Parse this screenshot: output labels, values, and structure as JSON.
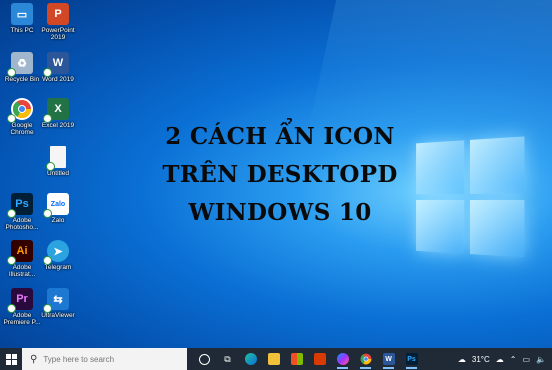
{
  "headline": {
    "line1": "2 CÁCH ẨN ICON",
    "line2": "TRÊN DESKTOPD",
    "line3": "WINDOWS 10"
  },
  "desktop_icons": [
    {
      "label": "This PC",
      "icon": "this-pc-icon",
      "color": "#2b88d8"
    },
    {
      "label": "PowerPoint 2019",
      "icon": "powerpoint-icon",
      "color": "#d24726"
    },
    {
      "label": "Recycle Bin",
      "icon": "recycle-bin-icon",
      "color": "#9fb6cc"
    },
    {
      "label": "Word 2019",
      "icon": "word-icon",
      "color": "#2b579a"
    },
    {
      "label": "Google Chrome",
      "icon": "chrome-icon",
      "color": "#e8453c"
    },
    {
      "label": "Excel 2019",
      "icon": "excel-icon",
      "color": "#217346"
    },
    {
      "label": "Untitled",
      "icon": "document-icon",
      "color": "#f5f5f5"
    },
    {
      "label": "Adobe Photosho...",
      "icon": "photoshop-icon",
      "color": "#001e36"
    },
    {
      "label": "Zalo",
      "icon": "zalo-icon",
      "color": "#0068ff"
    },
    {
      "label": "Adobe Illustrat...",
      "icon": "illustrator-icon",
      "color": "#330000"
    },
    {
      "label": "Telegram",
      "icon": "telegram-icon",
      "color": "#2aa3e0"
    },
    {
      "label": "Adobe Premiere P...",
      "icon": "premiere-icon",
      "color": "#2a0a3c"
    },
    {
      "label": "UltraViewer",
      "icon": "ultraviewer-icon",
      "color": "#1c78d0"
    }
  ],
  "taskbar": {
    "search_placeholder": "Type here to search",
    "apps": [
      "cortana-icon",
      "task-view-icon",
      "edge-icon",
      "file-explorer-icon",
      "store-icon",
      "office-icon",
      "messenger-icon",
      "chrome-icon",
      "word-icon",
      "photoshop-icon"
    ],
    "temperature": "31°C"
  }
}
